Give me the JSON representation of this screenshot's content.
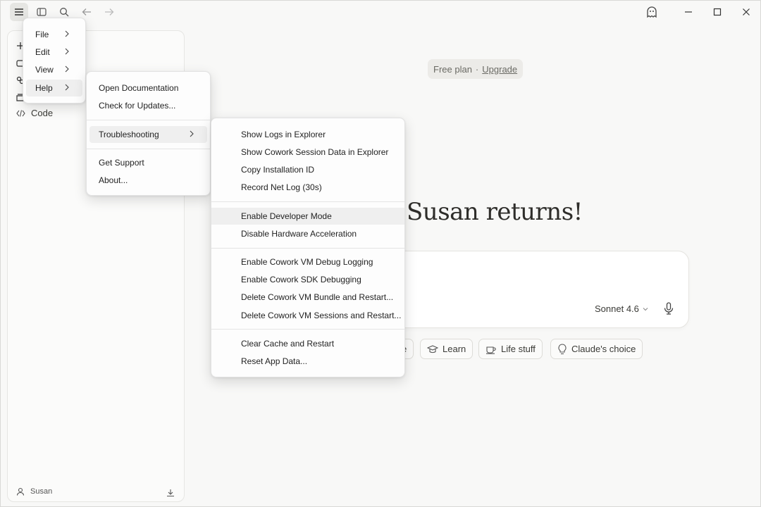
{
  "titlebar": {
    "icons": [
      "menu-icon",
      "sidebar-toggle-icon",
      "search-icon",
      "back-arrow-icon",
      "forward-arrow-icon",
      "ghost-icon",
      "minimize-icon",
      "maximize-icon",
      "close-icon"
    ]
  },
  "sidebar": {
    "items": [
      {
        "icon": "plus-icon",
        "label": ""
      },
      {
        "icon": "chat-icon",
        "label": ""
      },
      {
        "icon": "projects-icon",
        "label": ""
      },
      {
        "icon": "artifacts-icon",
        "label": ""
      },
      {
        "icon": "code-icon",
        "label": "Code"
      }
    ],
    "user_name": "Susan",
    "download_icon": "download-icon"
  },
  "main": {
    "plan": "Free plan",
    "separator": "·",
    "upgrade": "Upgrade",
    "greeting": "Susan returns!",
    "model": "Sonnet 4.6",
    "chips": [
      {
        "icon": "partial-icon",
        "label": "e"
      },
      {
        "icon": "graduation-cap-icon",
        "label": "Learn"
      },
      {
        "icon": "coffee-icon",
        "label": "Life stuff"
      },
      {
        "icon": "lightbulb-icon",
        "label": "Claude's choice"
      }
    ]
  },
  "menus": {
    "app_menu": [
      "File",
      "Edit",
      "View",
      "Help"
    ],
    "help_menu": [
      "Open Documentation",
      "Check for Updates...",
      "Troubleshooting",
      "Get Support",
      "About..."
    ],
    "troubleshooting_menu": [
      "Show Logs in Explorer",
      "Show Cowork Session Data in Explorer",
      "Copy Installation ID",
      "Record Net Log (30s)",
      "Enable Developer Mode",
      "Disable Hardware Acceleration",
      "Enable Cowork VM Debug Logging",
      "Enable Cowork SDK Debugging",
      "Delete Cowork VM Bundle and Restart...",
      "Delete Cowork VM Sessions and Restart...",
      "Clear Cache and Restart",
      "Reset App Data..."
    ]
  },
  "colors": {
    "background": "#f8f8f7",
    "menu_background": "#fdfdfd",
    "highlight": "#efefef",
    "text": "#2b2b28"
  }
}
